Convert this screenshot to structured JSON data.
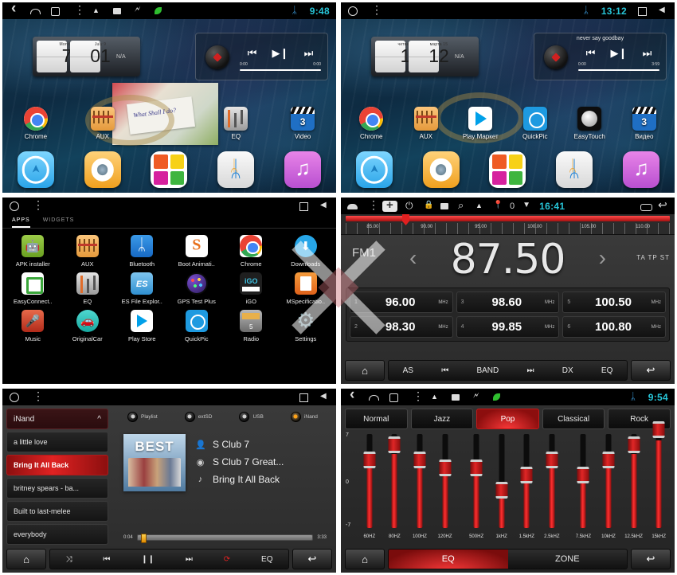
{
  "panels": {
    "home1": {
      "name": "home-screen-english",
      "statusbar": {
        "time": "9:48",
        "icons": [
          "back-icon",
          "home-icon",
          "recents-icon",
          "menu-icon",
          "warning-icon",
          "screenshot-icon",
          "usb-icon",
          "leaf-icon",
          "bluetooth-icon"
        ]
      },
      "clock_widget": {
        "day_label": "Monday",
        "day_number": "7",
        "month_label": "July 9",
        "month_number": "01",
        "weather": "N/A"
      },
      "media_widget": {
        "title": "",
        "elapsed": "0:00",
        "duration": "0:00",
        "prev": "⏮",
        "playpause": "▶❙",
        "next": "⏭"
      },
      "photo_widget": {
        "caption": "What Shall I do?"
      },
      "apps": [
        {
          "label": "Chrome",
          "icon": "chrome-icon"
        },
        {
          "label": "AUX",
          "icon": "aux-icon"
        },
        {
          "label": "",
          "icon": "photo-widget"
        },
        {
          "label": "EQ",
          "icon": "eq-icon"
        },
        {
          "label": "Video",
          "icon": "video-icon"
        }
      ],
      "dock": [
        {
          "label": "Navigation",
          "icon": "navigation-icon"
        },
        {
          "label": "Disc",
          "icon": "disc-icon"
        },
        {
          "label": "Apps",
          "icon": "quad-apps-icon"
        },
        {
          "label": "Bluetooth",
          "icon": "bluetooth-icon"
        },
        {
          "label": "Music",
          "icon": "music-icon"
        }
      ]
    },
    "home2": {
      "name": "home-screen-russian",
      "statusbar": {
        "time": "13:12",
        "icons": [
          "home-circle-icon",
          "menu-icon",
          "bluetooth-icon",
          "square-icon",
          "back-triangle-icon"
        ]
      },
      "clock_widget": {
        "day_label": "четверг",
        "day_number": "1",
        "month_label": "марта 15",
        "month_number": "12",
        "weather": "N/A"
      },
      "media_widget": {
        "title": "never say goodbay",
        "elapsed": "0:00",
        "duration": "3:59",
        "prev": "⏮",
        "playpause": "▶❙",
        "next": "⏭"
      },
      "apps": [
        {
          "label": "Chrome",
          "icon": "chrome-icon"
        },
        {
          "label": "AUX",
          "icon": "aux-icon"
        },
        {
          "label": "Play Маркет",
          "icon": "play-store-icon"
        },
        {
          "label": "QuickPic",
          "icon": "quickpic-icon"
        },
        {
          "label": "EasyTouch",
          "icon": "easytouch-icon"
        },
        {
          "label": "Видео",
          "icon": "video-icon"
        }
      ],
      "dock": [
        {
          "label": "Navigation",
          "icon": "navigation-icon"
        },
        {
          "label": "Disc",
          "icon": "disc-icon"
        },
        {
          "label": "Apps",
          "icon": "quad-apps-icon"
        },
        {
          "label": "Bluetooth",
          "icon": "bluetooth-icon"
        },
        {
          "label": "Music",
          "icon": "music-icon"
        }
      ]
    },
    "drawer": {
      "name": "app-drawer",
      "statusbar": {
        "icons": [
          "home-circle-icon",
          "menu-icon",
          "square-icon",
          "back-triangle-icon"
        ]
      },
      "tabs": [
        {
          "label": "APPS",
          "active": true
        },
        {
          "label": "WIDGETS",
          "active": false
        }
      ],
      "apps": [
        {
          "label": "APK installer",
          "icon": "apk-installer-icon"
        },
        {
          "label": "AUX",
          "icon": "aux-icon"
        },
        {
          "label": "Bluetooth",
          "icon": "bluetooth-icon"
        },
        {
          "label": "Boot Animati..",
          "icon": "boot-animation-icon"
        },
        {
          "label": "Chrome",
          "icon": "chrome-icon"
        },
        {
          "label": "Downloads",
          "icon": "downloads-icon"
        },
        {
          "label": "EasyConnect..",
          "icon": "easyconnect-icon"
        },
        {
          "label": "EQ",
          "icon": "eq-icon"
        },
        {
          "label": "ES File Explor..",
          "icon": "es-file-explorer-icon"
        },
        {
          "label": "GPS Test Plus",
          "icon": "gps-test-icon"
        },
        {
          "label": "iGO",
          "icon": "igo-icon"
        },
        {
          "label": "MSpecificatio..",
          "icon": "mspecification-icon"
        },
        {
          "label": "Music",
          "icon": "music-app-icon"
        },
        {
          "label": "OriginalCar",
          "icon": "original-car-icon"
        },
        {
          "label": "Play Store",
          "icon": "play-store-icon"
        },
        {
          "label": "QuickPic",
          "icon": "quickpic-icon"
        },
        {
          "label": "Radio",
          "icon": "radio-icon"
        },
        {
          "label": "Settings",
          "icon": "settings-icon"
        }
      ]
    },
    "radio": {
      "name": "fm-radio",
      "statusbar": {
        "time": "16:41",
        "counter": "0",
        "icons": [
          "home-icon",
          "menu-icon",
          "plus-badge-icon",
          "power-icon",
          "lock-icon",
          "screenshot-icon",
          "search-icon",
          "warning-icon",
          "location-icon",
          "wifi-icon",
          "recents-icon",
          "back-icon"
        ]
      },
      "scale": {
        "ticks": [
          "85.00",
          "90.00",
          "95.00",
          "100.00",
          "105.00",
          "110.00"
        ],
        "min": 85,
        "max": 110,
        "needle": 87.5
      },
      "band": "FM1",
      "frequency": "87.50",
      "rds_flags": "TA TP ST",
      "prev_arrow": "‹",
      "next_arrow": "›",
      "presets": [
        {
          "index": "1",
          "value": "96.00",
          "unit": "MHz"
        },
        {
          "index": "3",
          "value": "98.60",
          "unit": "MHz"
        },
        {
          "index": "5",
          "value": "100.50",
          "unit": "MHz"
        },
        {
          "index": "2",
          "value": "98.30",
          "unit": "MHz"
        },
        {
          "index": "4",
          "value": "99.85",
          "unit": "MHz"
        },
        {
          "index": "6",
          "value": "100.80",
          "unit": "MHz"
        }
      ],
      "bottom": {
        "home": "⌂",
        "back": "↩",
        "buttons": [
          "AS",
          "⏮",
          "BAND",
          "⏭",
          "DX",
          "EQ"
        ]
      }
    },
    "music": {
      "name": "music-player",
      "statusbar": {
        "icons": [
          "home-circle-icon",
          "menu-icon",
          "square-icon",
          "back-triangle-icon"
        ]
      },
      "source_label": "iNand",
      "playlist": [
        {
          "label": "a little love",
          "selected": false
        },
        {
          "label": "Bring It All Back",
          "selected": true
        },
        {
          "label": "britney spears - ba...",
          "selected": false
        },
        {
          "label": "Built to last-melee",
          "selected": false
        },
        {
          "label": "everybody",
          "selected": false
        }
      ],
      "sources": [
        {
          "label": "Playlist",
          "on": false
        },
        {
          "label": "extSD",
          "on": false
        },
        {
          "label": "USB",
          "on": false
        },
        {
          "label": "iNand",
          "on": true
        }
      ],
      "album": {
        "art_text": "BEST"
      },
      "now_playing": {
        "artist": "S Club 7",
        "album": "S Club 7 Great...",
        "track": "Bring It All Back",
        "artist_icon": "person-icon",
        "album_icon": "disc-icon",
        "track_icon": "note-icon"
      },
      "seek": {
        "elapsed": "0:04",
        "duration": "3:33",
        "percent": 2
      },
      "bottom": {
        "home": "⌂",
        "back": "↩",
        "buttons": [
          "⤨",
          "⏮",
          "❙❙",
          "⏭",
          "⟳",
          "EQ"
        ]
      }
    },
    "equalizer": {
      "name": "equalizer",
      "statusbar": {
        "time": "9:54",
        "icons": [
          "back-icon",
          "home-icon",
          "recents-icon",
          "menu-icon",
          "warning-icon",
          "screenshot-icon",
          "usb-icon",
          "leaf-icon",
          "bluetooth-icon"
        ]
      },
      "presets": [
        {
          "label": "Normal",
          "active": false
        },
        {
          "label": "Jazz",
          "active": false
        },
        {
          "label": "Pop",
          "active": true
        },
        {
          "label": "Classical",
          "active": false
        },
        {
          "label": "Rock",
          "active": false
        }
      ],
      "axis": {
        "top": "7",
        "mid": "0",
        "bottom": "-7"
      },
      "bands": [
        {
          "label": "60HZ",
          "value": 2
        },
        {
          "label": "80HZ",
          "value": 4
        },
        {
          "label": "100HZ",
          "value": 2
        },
        {
          "label": "120HZ",
          "value": 1
        },
        {
          "label": "500HZ",
          "value": 1
        },
        {
          "label": "1kHZ",
          "value": -2
        },
        {
          "label": "1.5kHZ",
          "value": 0
        },
        {
          "label": "2.5kHZ",
          "value": 2
        },
        {
          "label": "7.5kHZ",
          "value": 0
        },
        {
          "label": "10kHZ",
          "value": 2
        },
        {
          "label": "12.5kHZ",
          "value": 4
        },
        {
          "label": "15kHZ",
          "value": 6
        }
      ],
      "bottom": {
        "home": "⌂",
        "back": "↩",
        "tabs": [
          {
            "label": "EQ",
            "active": true
          },
          {
            "label": "ZONE",
            "active": false
          }
        ]
      }
    }
  },
  "colors": {
    "accent_red": "#e02222",
    "status_cyan": "#27c5d8",
    "panel_bg": "#2b2b2b"
  }
}
